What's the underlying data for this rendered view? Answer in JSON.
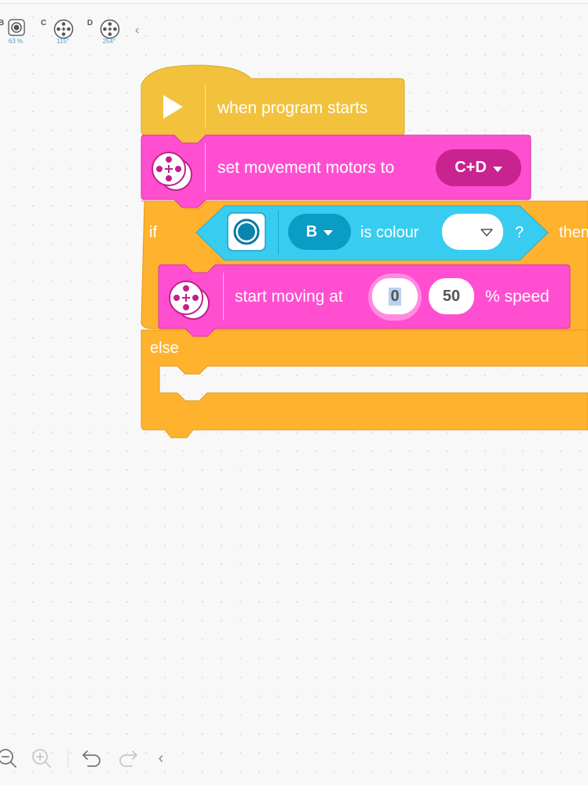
{
  "ports": [
    {
      "letter": "B",
      "value": "63 %",
      "device": "color-sensor"
    },
    {
      "letter": "C",
      "value": "115°",
      "device": "motor"
    },
    {
      "letter": "D",
      "value": "254°",
      "device": "motor"
    }
  ],
  "blocks": {
    "start": {
      "label": "when program starts"
    },
    "set_motors": {
      "label": "set movement motors to",
      "value": "C+D"
    },
    "if_else": {
      "if_label": "if",
      "then_label": "then",
      "else_label": "else",
      "condition": {
        "port": "B",
        "label": "is colour",
        "help": "?"
      }
    },
    "start_moving": {
      "label": "start moving at",
      "steer_value": "0",
      "speed_value": "50",
      "suffix": "% speed"
    }
  },
  "colors": {
    "events": "#f2c23d",
    "movement": "#ff4fd0",
    "control": "#ffb22e",
    "sensor": "#38cdf0"
  },
  "toolbar": {
    "zoom_out": "zoom-out",
    "zoom_in": "zoom-in",
    "undo": "undo",
    "redo": "redo",
    "collapse": "collapse"
  }
}
